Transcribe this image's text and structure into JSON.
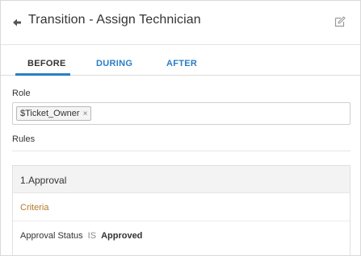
{
  "header": {
    "title": "Transition - Assign Technician"
  },
  "tabs": [
    {
      "label": "BEFORE",
      "active": true
    },
    {
      "label": "DURING",
      "active": false
    },
    {
      "label": "AFTER",
      "active": false
    }
  ],
  "form": {
    "role_label": "Role",
    "role_chips": [
      "$Ticket_Owner"
    ],
    "chip_remove_symbol": "×",
    "rules_label": "Rules"
  },
  "rules": [
    {
      "title": "1.Approval",
      "criteria_label": "Criteria",
      "conditions": [
        {
          "field": "Approval Status",
          "operator": "IS",
          "value": "Approved"
        }
      ]
    }
  ],
  "colors": {
    "accent": "#2a7ec4",
    "criteria": "#b07a2a",
    "rule_header_bg": "#f3f3f3"
  },
  "icons": {
    "back": "back-arrow-icon",
    "edit": "edit-icon"
  }
}
